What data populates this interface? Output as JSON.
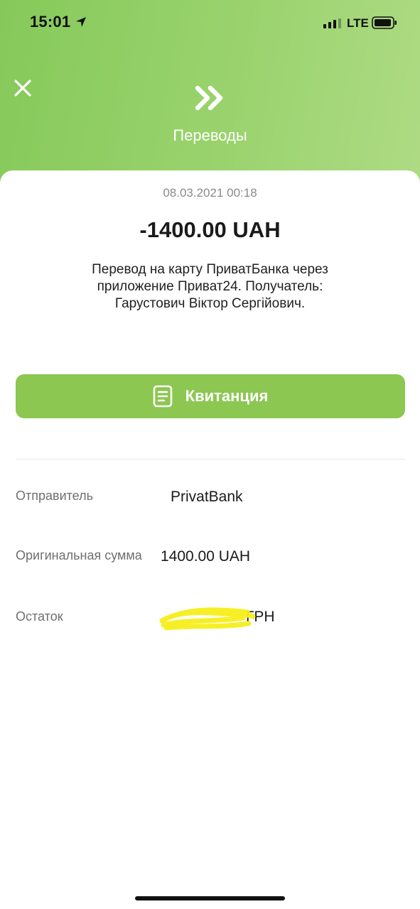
{
  "status_bar": {
    "time": "15:01",
    "network": "LTE"
  },
  "header": {
    "title": "Переводы",
    "icon": "double-chevron-right-icon",
    "close_icon": "close-icon"
  },
  "transaction": {
    "date": "08.03.2021 00:18",
    "amount": "-1400.00 UAH",
    "description_lines": [
      "Перевод на карту ПриватБанка через",
      "приложение Приват24. Получатель:",
      "Гарустович Віктор Сергійович."
    ]
  },
  "receipt_button": {
    "label": "Квитанция",
    "icon": "document-icon"
  },
  "details": [
    {
      "label": "Отправитель",
      "value": "PrivatBank"
    },
    {
      "label": "Оригинальная сумма",
      "value": "1400.00 UAH"
    },
    {
      "label": "Остаток",
      "value": "ГРН"
    }
  ],
  "colors": {
    "header_green": "#8fcb60",
    "button_green": "#8cc751",
    "redaction_yellow": "#f5ee1a"
  }
}
